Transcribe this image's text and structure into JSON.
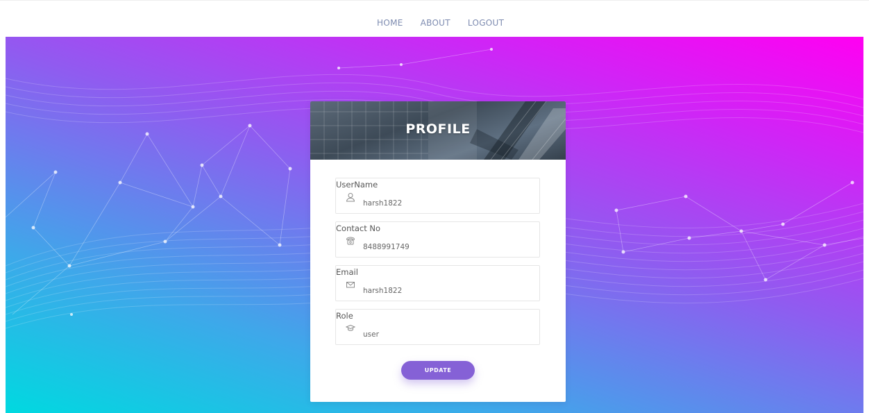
{
  "nav": {
    "items": [
      {
        "label": "HOME"
      },
      {
        "label": "ABOUT"
      },
      {
        "label": "LOGOUT"
      }
    ]
  },
  "card": {
    "title": "PROFILE",
    "fields": [
      {
        "label": "UserName",
        "value": "harsh1822",
        "icon": "user-icon"
      },
      {
        "label": "Contact No",
        "value": "8488991749",
        "icon": "phone-icon"
      },
      {
        "label": "Email",
        "value": "harsh1822",
        "icon": "envelope-icon"
      },
      {
        "label": "Role",
        "value": "user",
        "icon": "graduation-cap-icon"
      }
    ],
    "update_label": "UPDATE"
  },
  "colors": {
    "accent": "#8561d6",
    "nav_text": "#7d8bb0",
    "gradient_left": "#00d9e0",
    "gradient_right": "#ff00f2"
  }
}
